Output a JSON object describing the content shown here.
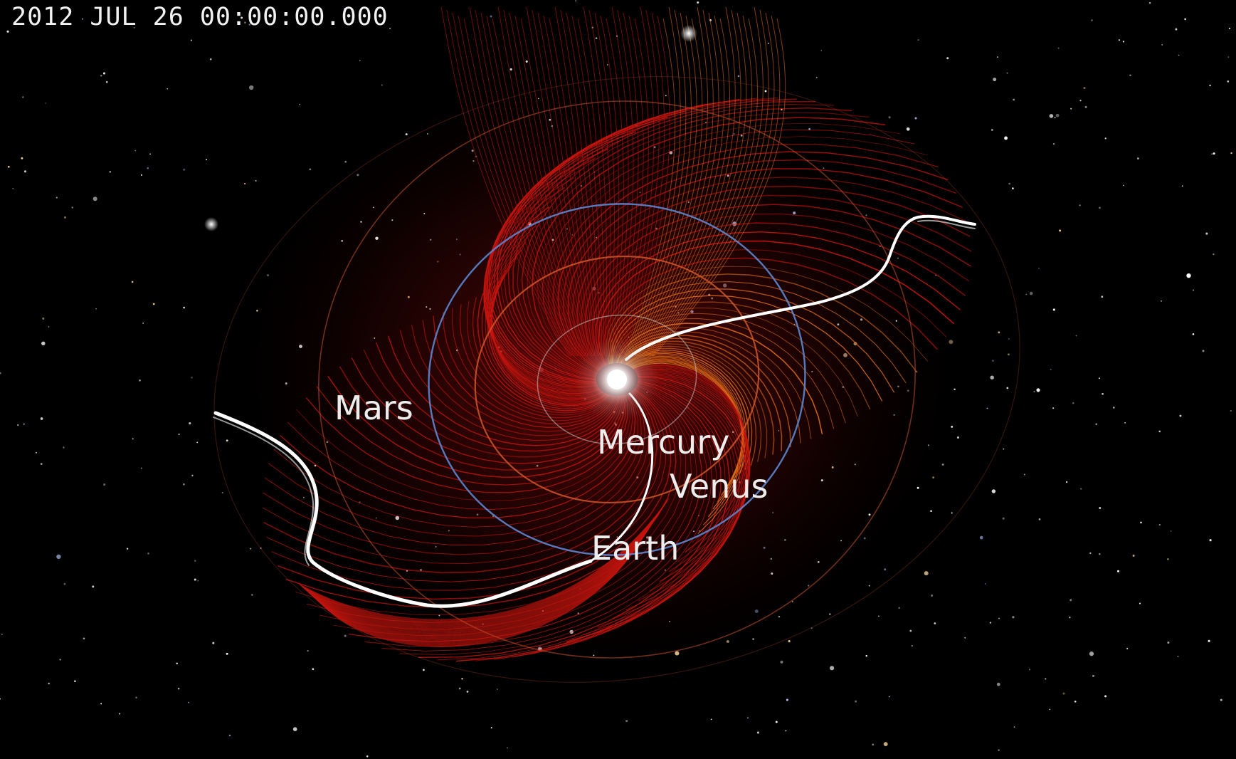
{
  "timestamp": "2012 JUL 26 00:00:00.000",
  "planets": {
    "mars": "Mars",
    "mercury": "Mercury",
    "venus": "Venus",
    "earth": "Earth"
  },
  "colors": {
    "background": "#000000",
    "field_lines": "#c8150f",
    "field_lines_highlight": "#e8701a",
    "earth_orbit": "#5d86d0",
    "venus_orbit": "#d85a2a",
    "mars_orbit": "#c8542e",
    "mercury_orbit": "#c8c8c8",
    "heliospheric_current_sheet": "#ffffff",
    "sun": "#ffffff"
  }
}
